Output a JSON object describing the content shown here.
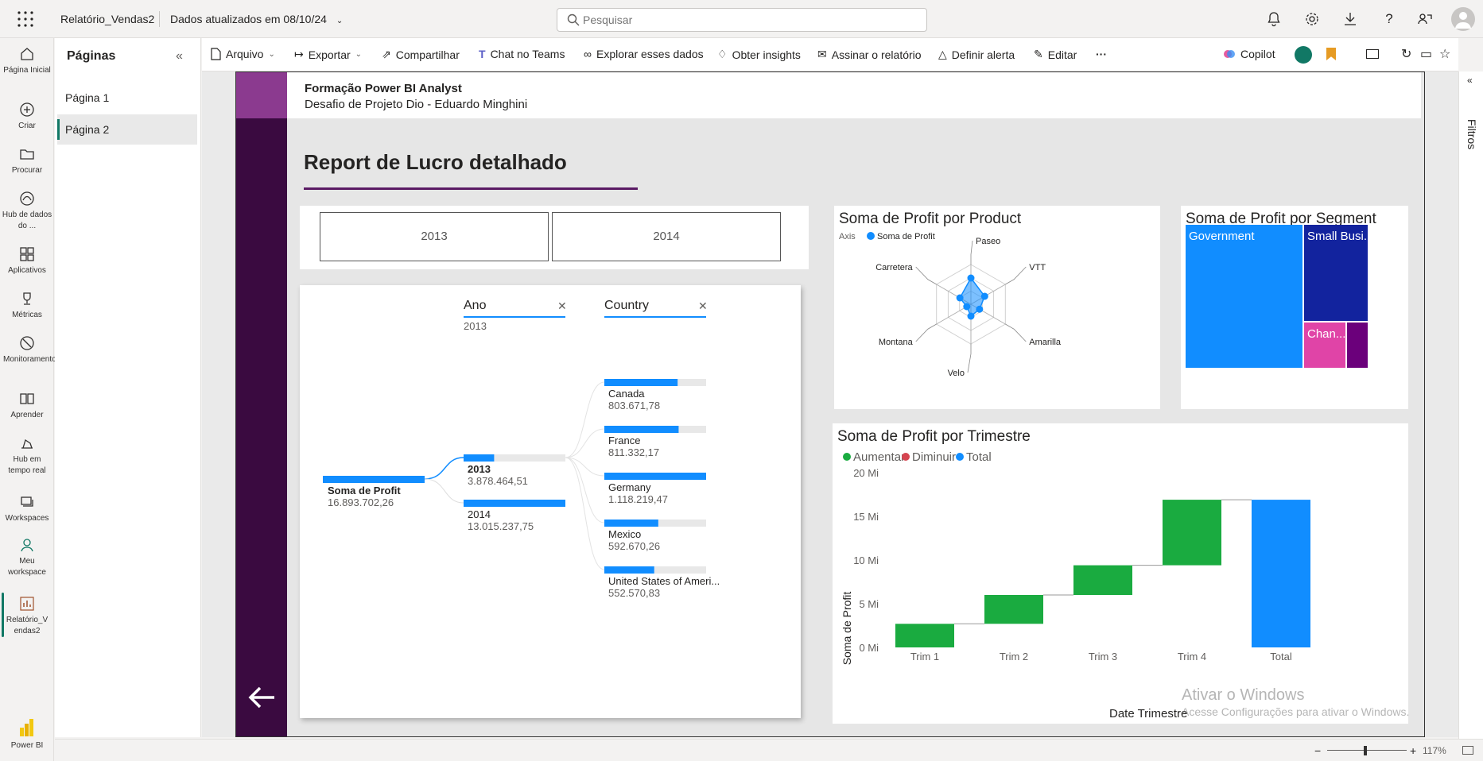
{
  "topbar": {
    "report_name": "Relatório_Vendas2",
    "updated": "Dados atualizados em 08/10/24",
    "search_placeholder": "Pesquisar"
  },
  "leftrail": {
    "items": [
      {
        "label": "Página Inicial",
        "icon": "home-icon"
      },
      {
        "label": "Criar",
        "icon": "plus-circle-icon"
      },
      {
        "label": "Procurar",
        "icon": "folder-icon"
      },
      {
        "label": "Hub de dados do ...",
        "icon": "data-hub-icon"
      },
      {
        "label": "Aplicativos",
        "icon": "apps-icon"
      },
      {
        "label": "Métricas",
        "icon": "trophy-icon"
      },
      {
        "label": "Monitoramento",
        "icon": "monitor-icon"
      },
      {
        "label": "Aprender",
        "icon": "book-icon"
      },
      {
        "label": "Hub em tempo real",
        "icon": "realtime-icon"
      },
      {
        "label": "Workspaces",
        "icon": "workspaces-icon"
      },
      {
        "label": "Meu workspace",
        "icon": "person-icon"
      },
      {
        "label": "Relatório_Vendas2",
        "icon": "report-icon"
      }
    ],
    "brand": "Power BI"
  },
  "pages": {
    "title": "Páginas",
    "items": [
      "Página 1",
      "Página 2"
    ],
    "active": "Página 2"
  },
  "toolbar": {
    "arquivo": "Arquivo",
    "exportar": "Exportar",
    "compartilhar": "Compartilhar",
    "chat_teams": "Chat no Teams",
    "explorar": "Explorar esses dados",
    "insights": "Obter insights",
    "assinar": "Assinar o relatório",
    "alerta": "Definir alerta",
    "editar": "Editar",
    "more": "···",
    "copilot": "Copilot"
  },
  "filters": {
    "label": "Filtros"
  },
  "report": {
    "course_title": "Formação Power BI Analyst",
    "course_sub": "Desafio de Projeto Dio - Eduardo Minghini",
    "title": "Report de Lucro detalhado",
    "slicer_years": [
      "2013",
      "2014"
    ]
  },
  "decomp": {
    "col_ano": "Ano",
    "col_ano_value": "2013",
    "col_country": "Country",
    "root_label": "Soma de Profit",
    "root_value": "16.893.702,26",
    "years": [
      {
        "label": "2013",
        "value": "3.878.464,51",
        "fill": 0.3,
        "bold": true
      },
      {
        "label": "2014",
        "value": "13.015.237,75",
        "fill": 1.0,
        "bold": false
      }
    ],
    "countries": [
      {
        "label": "Canada",
        "value": "803.671,78",
        "fill": 0.72
      },
      {
        "label": "France",
        "value": "811.332,17",
        "fill": 0.73
      },
      {
        "label": "Germany",
        "value": "1.118.219,47",
        "fill": 1.0
      },
      {
        "label": "Mexico",
        "value": "592.670,26",
        "fill": 0.53
      },
      {
        "label": "United States of Ameri...",
        "value": "552.570,83",
        "fill": 0.49
      }
    ]
  },
  "radar": {
    "title": "Soma de Profit por Product",
    "legend_axis": "Axis",
    "legend_series": "Soma de Profit",
    "color": "#118dff",
    "axes": [
      "Paseo",
      "VTT",
      "Amarilla",
      "Velo",
      "Montana",
      "Carretera"
    ],
    "values": [
      0.66,
      0.4,
      0.25,
      0.3,
      0.12,
      0.32
    ]
  },
  "segment": {
    "title": "Soma de Profit por Segment",
    "blocks": [
      {
        "label": "Government",
        "color": "#118dff"
      },
      {
        "label": "Small Busi...",
        "color": "#12239e"
      },
      {
        "label": "Chan...",
        "color": "#e044a7"
      },
      {
        "label": "",
        "color": "#6b007b"
      }
    ]
  },
  "chart_data": {
    "type": "waterfall",
    "title": "Soma de Profit por Trimestre",
    "xlabel": "Date Trimestre",
    "ylabel": "Soma de Profit",
    "legend": [
      {
        "name": "Aumentar",
        "color": "#1aab40"
      },
      {
        "name": "Diminuir",
        "color": "#d64550"
      },
      {
        "name": "Total",
        "color": "#118dff"
      }
    ],
    "y_ticks": [
      "0 Mi",
      "5 Mi",
      "10 Mi",
      "15 Mi",
      "20 Mi"
    ],
    "ylim": [
      0,
      20
    ],
    "categories": [
      "Trim 1",
      "Trim 2",
      "Trim 3",
      "Trim 4",
      "Total"
    ],
    "values": [
      2.7,
      3.3,
      3.4,
      7.5,
      16.9
    ],
    "kinds": [
      "increase",
      "increase",
      "increase",
      "increase",
      "total"
    ]
  },
  "status": {
    "zoom": "117%"
  },
  "watermark": {
    "line1": "Ativar o Windows",
    "line2": "Acesse Configurações para ativar o Windows."
  }
}
